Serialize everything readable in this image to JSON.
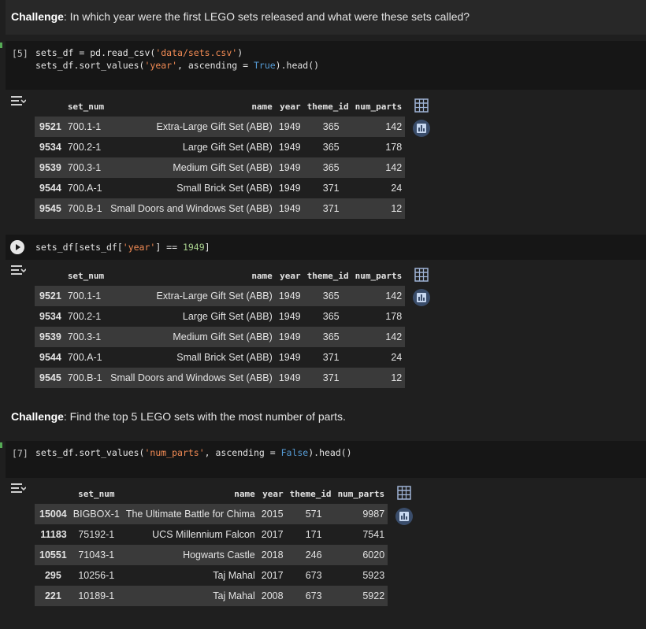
{
  "cells": [
    {
      "kind": "markdown",
      "bold": "Challenge",
      "text": ": In which year were the first LEGO sets released and what were these sets called?"
    },
    {
      "kind": "code",
      "exec_count": "[5]",
      "line1_a": "sets_df = pd.read_csv(",
      "line1_b": "'data/sets.csv'",
      "line1_c": ")",
      "line2_a": "sets_df.sort_values(",
      "line2_b": "'year'",
      "line2_c": ", ascending = ",
      "line2_d": "True",
      "line2_e": ").head()",
      "table": {
        "columns": [
          "",
          "set_num",
          "name",
          "year",
          "theme_id",
          "num_parts"
        ],
        "rows": [
          [
            "9521",
            "700.1-1",
            "Extra-Large Gift Set (ABB)",
            "1949",
            "365",
            "142"
          ],
          [
            "9534",
            "700.2-1",
            "Large Gift Set (ABB)",
            "1949",
            "365",
            "178"
          ],
          [
            "9539",
            "700.3-1",
            "Medium Gift Set (ABB)",
            "1949",
            "365",
            "142"
          ],
          [
            "9544",
            "700.A-1",
            "Small Brick Set (ABB)",
            "1949",
            "371",
            "24"
          ],
          [
            "9545",
            "700.B-1",
            "Small Doors and Windows Set (ABB)",
            "1949",
            "371",
            "12"
          ]
        ]
      }
    },
    {
      "kind": "code",
      "exec_count": "",
      "line1_a": "sets_df[sets_df[",
      "line1_b": "'year'",
      "line1_c": "] == ",
      "line1_d": "1949",
      "line1_e": "]",
      "table": {
        "columns": [
          "",
          "set_num",
          "name",
          "year",
          "theme_id",
          "num_parts"
        ],
        "rows": [
          [
            "9521",
            "700.1-1",
            "Extra-Large Gift Set (ABB)",
            "1949",
            "365",
            "142"
          ],
          [
            "9534",
            "700.2-1",
            "Large Gift Set (ABB)",
            "1949",
            "365",
            "178"
          ],
          [
            "9539",
            "700.3-1",
            "Medium Gift Set (ABB)",
            "1949",
            "365",
            "142"
          ],
          [
            "9544",
            "700.A-1",
            "Small Brick Set (ABB)",
            "1949",
            "371",
            "24"
          ],
          [
            "9545",
            "700.B-1",
            "Small Doors and Windows Set (ABB)",
            "1949",
            "371",
            "12"
          ]
        ]
      }
    },
    {
      "kind": "markdown",
      "bold": "Challenge",
      "text": ": Find the top 5 LEGO sets with the most number of parts."
    },
    {
      "kind": "code",
      "exec_count": "[7]",
      "line1_a": "sets_df.sort_values(",
      "line1_b": "'num_parts'",
      "line1_c": ", ascending = ",
      "line1_d": "False",
      "line1_e": ").head()",
      "table": {
        "columns": [
          "",
          "set_num",
          "name",
          "year",
          "theme_id",
          "num_parts"
        ],
        "rows": [
          [
            "15004",
            "BIGBOX-1",
            "The Ultimate Battle for Chima",
            "2015",
            "571",
            "9987"
          ],
          [
            "11183",
            "75192-1",
            "UCS Millennium Falcon",
            "2017",
            "171",
            "7541"
          ],
          [
            "10551",
            "71043-1",
            "Hogwarts Castle",
            "2018",
            "246",
            "6020"
          ],
          [
            "295",
            "10256-1",
            "Taj Mahal",
            "2017",
            "673",
            "5923"
          ],
          [
            "221",
            "10189-1",
            "Taj Mahal",
            "2008",
            "673",
            "5922"
          ]
        ]
      }
    }
  ],
  "icons": {
    "run": "play-icon",
    "output": "output-toggle-icon",
    "table": "table-view-icon",
    "chart": "chart-suggest-icon"
  }
}
